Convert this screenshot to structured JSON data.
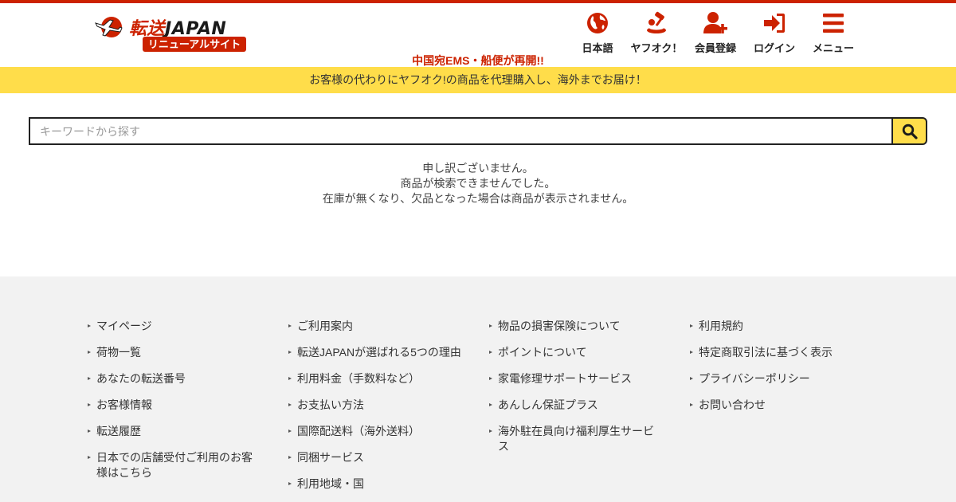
{
  "header": {
    "brand_prefix": "転送",
    "brand_name": "JAPAN",
    "renewal_badge": "リニューアルサイト",
    "notice": "中国宛EMS・船便が再開!!",
    "nav": [
      {
        "label": "日本語",
        "icon": "globe-icon"
      },
      {
        "label": "ヤフオク！",
        "icon": "auction-gavel-icon"
      },
      {
        "label": "会員登録",
        "icon": "user-plus-icon"
      },
      {
        "label": "ログイン",
        "icon": "sign-in-icon"
      },
      {
        "label": "メニュー",
        "icon": "hamburger-menu-icon"
      }
    ]
  },
  "banner": {
    "text": "お客様の代わりにヤフオク!の商品を代理購入し、海外までお届け！"
  },
  "search": {
    "placeholder": "キーワードから探す",
    "value": "",
    "button_icon": "search-icon"
  },
  "message": {
    "lines": [
      "申し訳ございません。",
      "商品が検索できませんでした。",
      "在庫が無くなり、欠品となった場合は商品が表示されません。"
    ]
  },
  "footer": {
    "columns": [
      [
        "マイページ",
        "荷物一覧",
        "あなたの転送番号",
        "お客様情報",
        "転送履歴",
        "日本での店舗受付ご利用のお客様はこちら"
      ],
      [
        "ご利用案内",
        "転送JAPANが選ばれる5つの理由",
        "利用料金（手数料など）",
        "お支払い方法",
        "国際配送料（海外送料）",
        "同梱サービス",
        "利用地域・国"
      ],
      [
        "物品の損害保険について",
        "ポイントについて",
        "家電修理サポートサービス",
        "あんしん保証プラス",
        "海外駐在員向け福利厚生サービス"
      ],
      [
        "利用規約",
        "特定商取引法に基づく表示",
        "プライバシーポリシー",
        "お問い合わせ"
      ]
    ]
  },
  "colors": {
    "accent_red": "#cc2200",
    "accent_yellow": "#ffdd4a",
    "footer_bg": "#f2f2f2"
  }
}
